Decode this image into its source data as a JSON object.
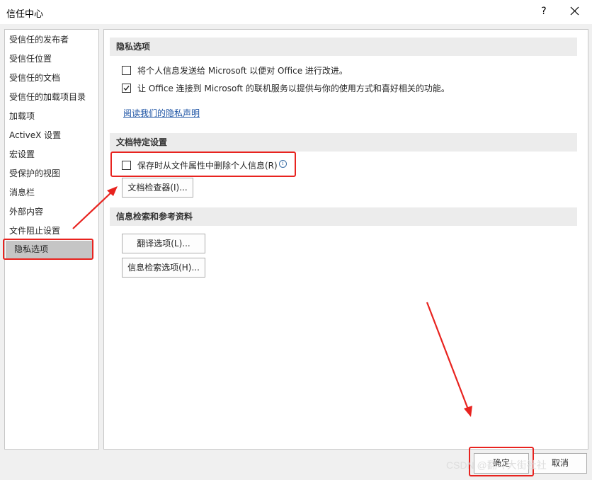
{
  "window": {
    "title": "信任中心",
    "help_glyph": "?"
  },
  "sidebar": {
    "items": [
      {
        "label": "受信任的发布者"
      },
      {
        "label": "受信任位置"
      },
      {
        "label": "受信任的文档"
      },
      {
        "label": "受信任的加载项目录"
      },
      {
        "label": "加载项"
      },
      {
        "label": "ActiveX 设置"
      },
      {
        "label": "宏设置"
      },
      {
        "label": "受保护的视图"
      },
      {
        "label": "消息栏"
      },
      {
        "label": "外部内容"
      },
      {
        "label": "文件阻止设置"
      },
      {
        "label": "隐私选项",
        "selected": true
      }
    ]
  },
  "privacy": {
    "header": "隐私选项",
    "option1": {
      "label": "将个人信息发送给 Microsoft 以便对 Office 进行改进。",
      "checked": false
    },
    "option2": {
      "label": "让 Office 连接到 Microsoft 的联机服务以提供与你的使用方式和喜好相关的功能。",
      "checked": true
    },
    "link": "阅读我们的隐私声明"
  },
  "document_settings": {
    "header": "文档特定设置",
    "remove_personal_info": {
      "label": "保存时从文件属性中删除个人信息(R)",
      "checked": false
    },
    "inspector_button": "文档检查器(I)..."
  },
  "research": {
    "header": "信息检索和参考资料",
    "translate_button": "翻译选项(L)...",
    "research_button": "信息检索选项(H)..."
  },
  "footer": {
    "ok_button": "确定",
    "cancel_button": "取消"
  },
  "watermark": "CSDN @翻斗大街社社",
  "colors": {
    "highlight_red": "#e8231f",
    "selected_bg": "#c5c5c5",
    "link": "#1f55a5"
  },
  "icons": [
    "close-icon",
    "info-icon",
    "checkbox-checked-icon"
  ]
}
